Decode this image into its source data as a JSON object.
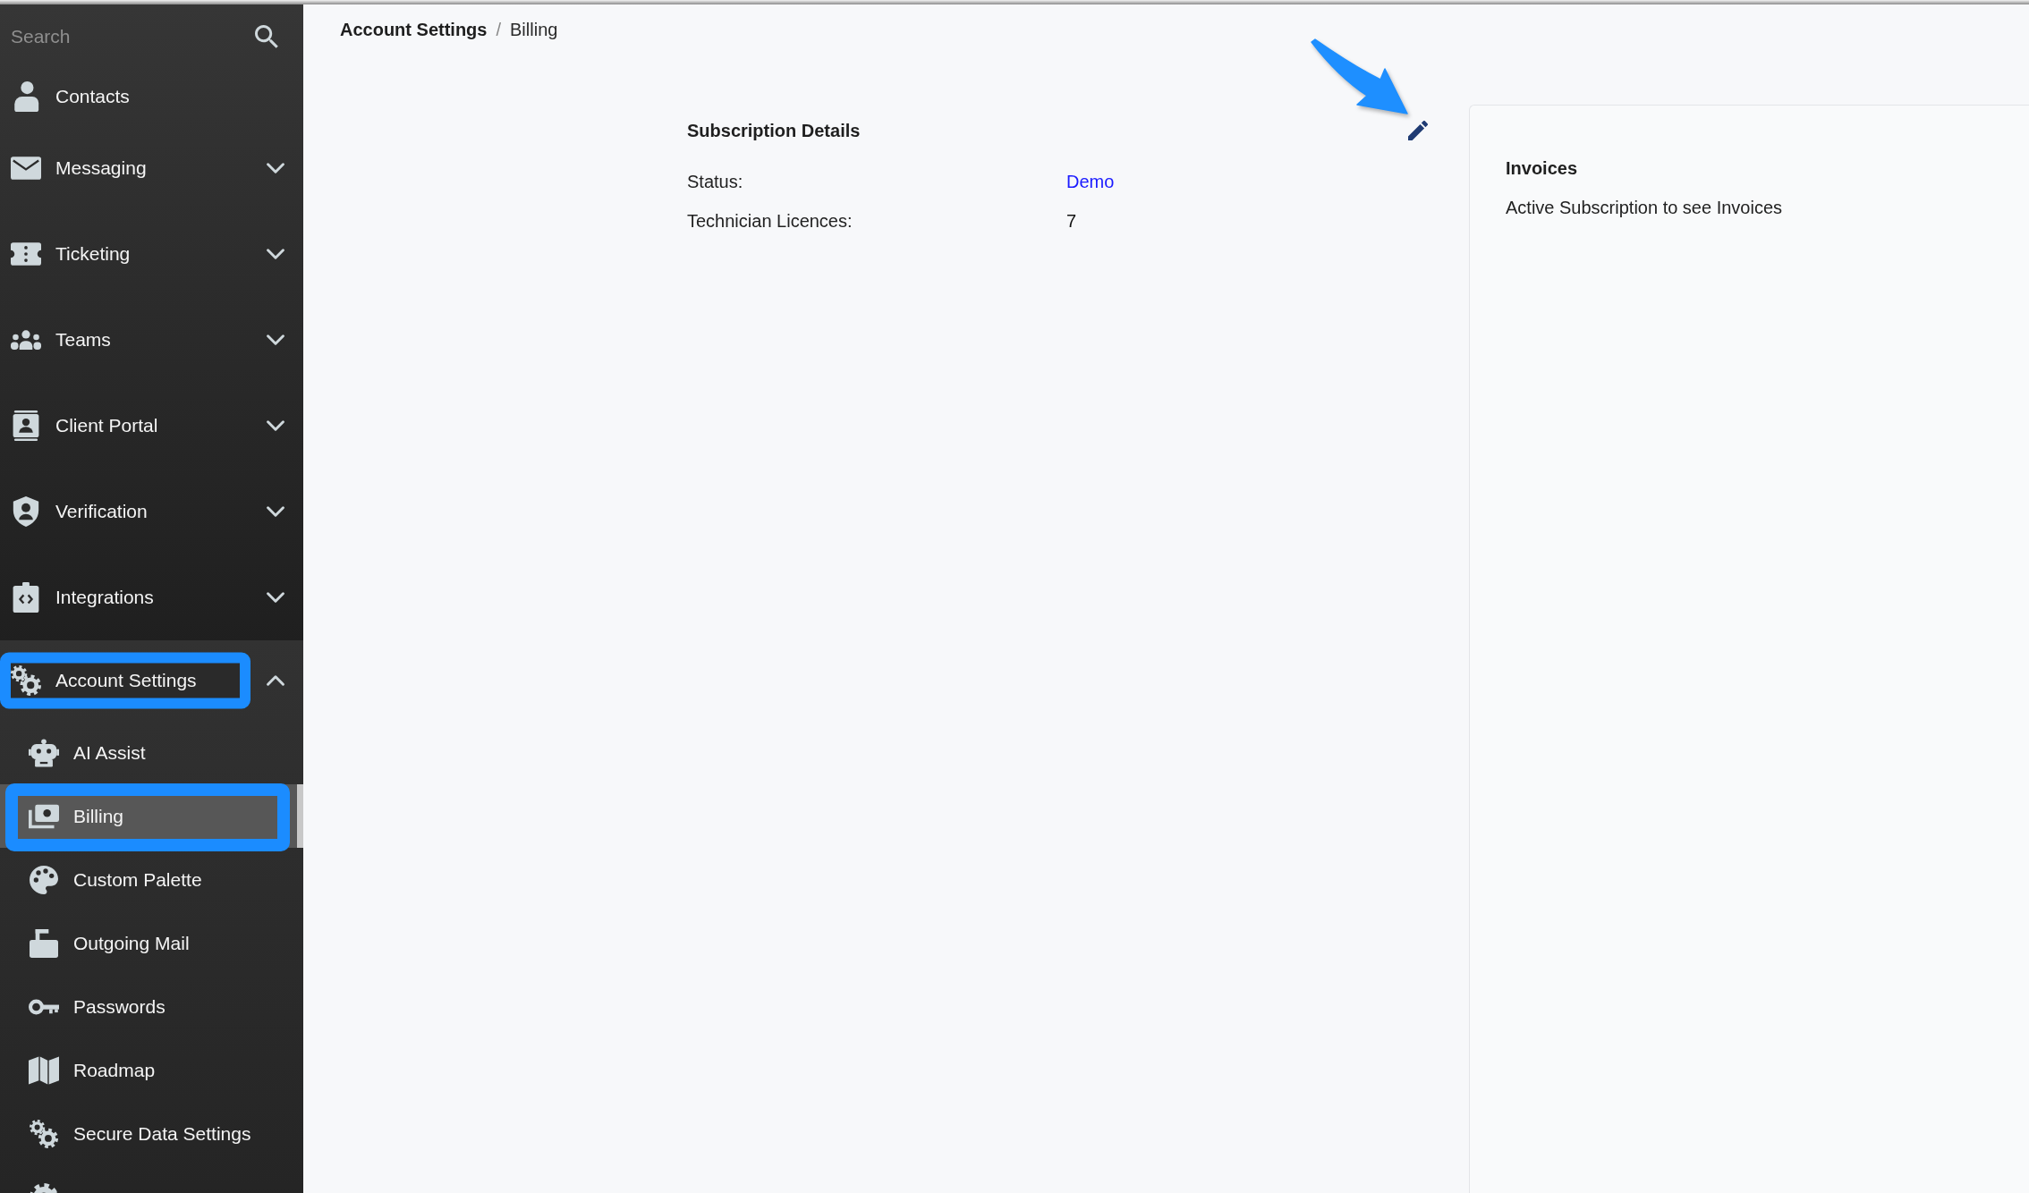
{
  "sidebar": {
    "search": {
      "placeholder": "Search"
    },
    "items": [
      {
        "kind": "link",
        "label": "Contacts",
        "annotated": false
      },
      {
        "kind": "group",
        "label": "Messaging",
        "expanded": false,
        "annotated": false
      },
      {
        "kind": "group",
        "label": "Ticketing",
        "expanded": false,
        "annotated": false
      },
      {
        "kind": "group",
        "label": "Teams",
        "expanded": false,
        "annotated": false
      },
      {
        "kind": "group",
        "label": "Client Portal",
        "expanded": false,
        "annotated": false
      },
      {
        "kind": "group",
        "label": "Verification",
        "expanded": false,
        "annotated": false
      },
      {
        "kind": "group",
        "label": "Integrations",
        "expanded": false,
        "annotated": false
      },
      {
        "kind": "group",
        "label": "Account Settings",
        "expanded": true,
        "annotated": true,
        "children": [
          {
            "label": "AI Assist",
            "selected": false,
            "annotated": false
          },
          {
            "label": "Billing",
            "selected": true,
            "annotated": true
          },
          {
            "label": "Custom Palette",
            "selected": false,
            "annotated": false
          },
          {
            "label": "Outgoing Mail",
            "selected": false,
            "annotated": false
          },
          {
            "label": "Passwords",
            "selected": false,
            "annotated": false
          },
          {
            "label": "Roadmap",
            "selected": false,
            "annotated": false
          },
          {
            "label": "Secure Data Settings",
            "selected": false,
            "annotated": false
          },
          {
            "selected": false,
            "annotated": false
          }
        ]
      }
    ]
  },
  "breadcrumb": {
    "separator": "/",
    "items": [
      {
        "label": "Account Settings",
        "current": false
      },
      {
        "label": "Billing",
        "current": true
      }
    ]
  },
  "subscription": {
    "title": "Subscription Details",
    "edit_button": {
      "annotated": true
    },
    "fields": [
      {
        "label": "Status:",
        "value": "Demo",
        "kind": "link"
      },
      {
        "label": "Technician Licences:",
        "value": "7",
        "kind": "text"
      }
    ]
  },
  "invoices": {
    "title": "Invoices",
    "message": "Active Subscription to see Invoices"
  }
}
